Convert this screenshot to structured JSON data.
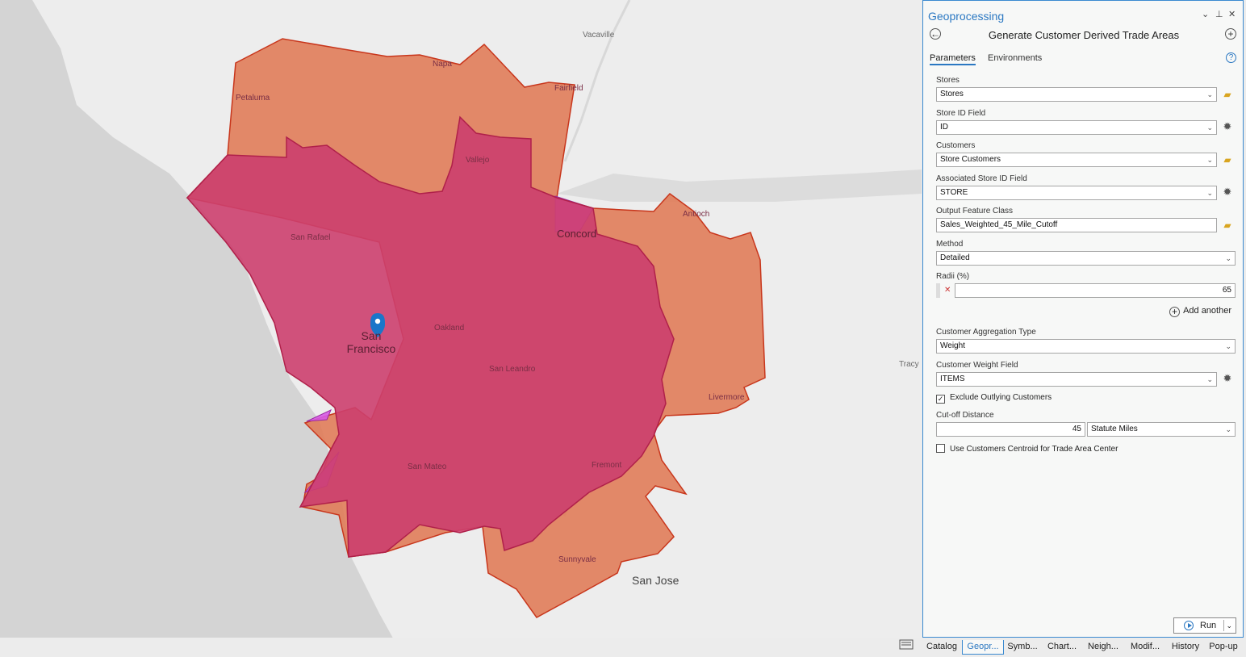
{
  "map": {
    "labels": {
      "vacaville": "Vacaville",
      "napa": "Napa",
      "fairfield": "Fairfield",
      "petaluma": "Petaluma",
      "vallejo": "Vallejo",
      "antioch": "Antioch",
      "concord": "Concord",
      "san_rafael": "San Rafael",
      "oakland": "Oakland",
      "san_francisco": "San Francisco",
      "san_leandro": "San Leandro",
      "tracy": "Tracy",
      "livermore": "Livermore",
      "san_mateo": "San Mateo",
      "fremont": "Fremont",
      "sunnyvale": "Sunnyvale",
      "san_jose": "San Jose"
    },
    "colors": {
      "outer_fill": "#e07a55",
      "outer_stroke": "#c8361c",
      "inner_fill": "#cc3f6e",
      "inner_stroke": "#b0204a",
      "purple_fill": "#d75ae6",
      "marker": "#1a76c9",
      "water": "#d3d3d3",
      "land": "#ededed"
    }
  },
  "pane": {
    "title": "Geoprocessing",
    "controls": {
      "dropdown": "⌄",
      "pin": "⊥",
      "close": "✕"
    },
    "tool_title": "Generate Customer Derived Trade Areas",
    "back_icon": "←",
    "add_icon": "+",
    "tabs": [
      "Parameters",
      "Environments"
    ],
    "help_icon": "?",
    "params": {
      "stores_label": "Stores",
      "stores_value": "Stores",
      "store_id_label": "Store ID Field",
      "store_id_value": "ID",
      "customers_label": "Customers",
      "customers_value": "Store Customers",
      "assoc_label": "Associated Store ID Field",
      "assoc_value": "STORE",
      "output_label": "Output Feature Class",
      "output_value": "Sales_Weighted_45_Mile_Cutoff",
      "method_label": "Method",
      "method_value": "Detailed",
      "radii_label": "Radii (%)",
      "radii_value": "65",
      "add_another": "Add another",
      "agg_label": "Customer Aggregation Type",
      "agg_value": "Weight",
      "weight_label": "Customer Weight Field",
      "weight_value": "ITEMS",
      "exclude_label": "Exclude Outlying Customers",
      "exclude_checked": true,
      "cutoff_label": "Cut-off Distance",
      "cutoff_value": "45",
      "cutoff_units": "Statute Miles",
      "centroid_label": "Use Customers Centroid for Trade Area Center",
      "centroid_checked": false
    },
    "run_label": "Run"
  },
  "bottom_tabs": [
    "Catalog",
    "Geopr...",
    "Symb...",
    "Chart...",
    "Neigh...",
    "Modif...",
    "History",
    "Pop-up"
  ],
  "active_bottom_tab": "Geopr..."
}
